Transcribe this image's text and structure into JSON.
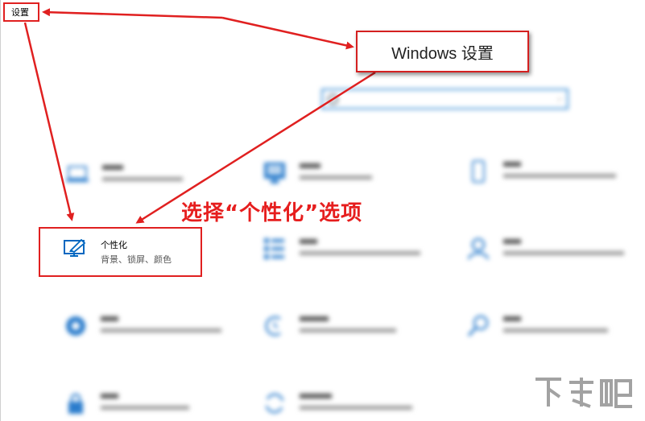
{
  "window": {
    "title": "设置"
  },
  "callout": {
    "text": "Windows 设置"
  },
  "annotation": {
    "instruction": "选择“个性化”选项"
  },
  "personalization": {
    "title": "个性化",
    "description": "背景、锁屏、颜色",
    "icon": "personalization-icon"
  },
  "blurred_tiles": [
    {
      "icon": "laptop-icon"
    },
    {
      "icon": "phone-keyboard-icon"
    },
    {
      "icon": "mobile-icon"
    },
    {
      "icon": "apps-icon"
    },
    {
      "icon": "account-icon"
    },
    {
      "icon": "gaming-icon"
    },
    {
      "icon": "time-language-icon"
    },
    {
      "icon": "search-icon"
    },
    {
      "icon": "privacy-lock-icon"
    },
    {
      "icon": "update-icon"
    }
  ],
  "colors": {
    "accent": "#0067c0",
    "annotation": "#e02020"
  }
}
